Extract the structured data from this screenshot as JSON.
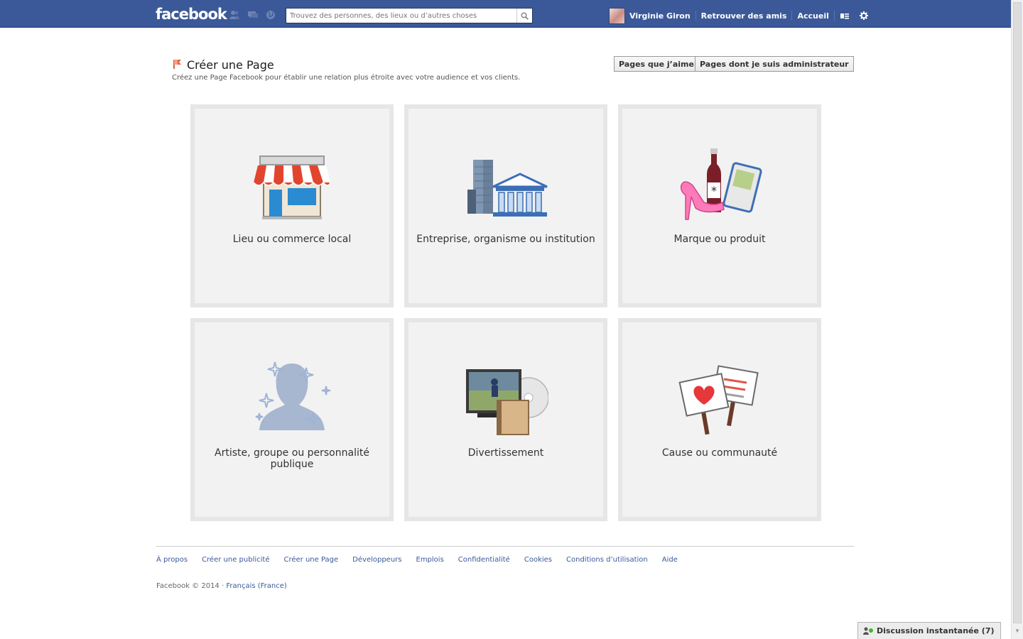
{
  "topbar": {
    "logo": "facebook",
    "search_placeholder": "Trouvez des personnes, des lieux ou d’autres choses",
    "user_name": "Virginie Giron",
    "find_friends": "Retrouver des amis",
    "home": "Accueil"
  },
  "header": {
    "title": "Créer une Page",
    "subtitle": "Créez une Page Facebook pour établir une relation plus étroite avec votre audience et vos clients.",
    "liked_pages_button": "Pages que j’aime",
    "admin_pages_button": "Pages dont je suis administrateur"
  },
  "categories": [
    {
      "label": "Lieu ou commerce local",
      "icon": "storefront-icon"
    },
    {
      "label": "Entreprise, organisme ou institution",
      "icon": "buildings-icon"
    },
    {
      "label": "Marque ou produit",
      "icon": "products-icon"
    },
    {
      "label": "Artiste, groupe ou personnalité publique",
      "icon": "star-person-icon"
    },
    {
      "label": "Divertissement",
      "icon": "entertainment-icon"
    },
    {
      "label": "Cause ou communauté",
      "icon": "signs-icon"
    }
  ],
  "footer": {
    "links": [
      "À propos",
      "Créer une publicité",
      "Créer une Page",
      "Développeurs",
      "Emplois",
      "Confidentialité",
      "Cookies",
      "Conditions d’utilisation",
      "Aide"
    ],
    "copyright": "Facebook © 2014 · ",
    "language": "Français (France)"
  },
  "chat": {
    "label": "Discussion instantanée (7)"
  },
  "colors": {
    "brand": "#3b5998",
    "card_bg": "#f2f2f2",
    "card_border": "#e6e6e6"
  }
}
